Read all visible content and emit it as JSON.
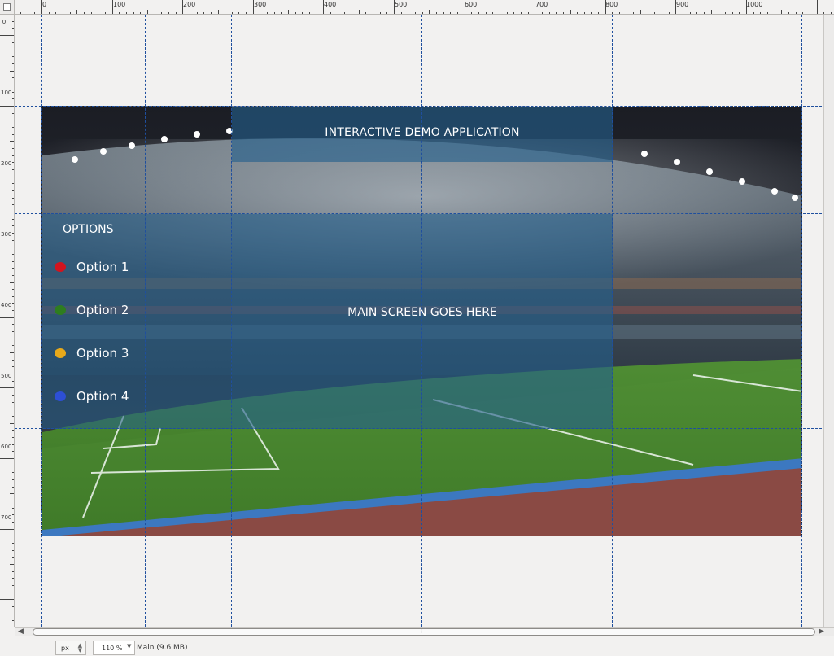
{
  "ruler": {
    "horizontal_labels": [
      "0",
      "100",
      "200",
      "300",
      "400",
      "500",
      "600",
      "700",
      "800",
      "900",
      "1000"
    ],
    "vertical_labels": [
      "0",
      "100",
      "200",
      "300",
      "400",
      "500",
      "600",
      "700"
    ]
  },
  "canvas": {
    "title": "INTERACTIVE DEMO APPLICATION",
    "main_screen": "MAIN SCREEN GOES HERE",
    "options_heading": "OPTIONS",
    "options": [
      {
        "label": "Option 1",
        "color": "#d2141e"
      },
      {
        "label": "Option 2",
        "color": "#2e7d1f"
      },
      {
        "label": "Option 3",
        "color": "#e8a91a"
      },
      {
        "label": "Option 4",
        "color": "#2d4fd6"
      }
    ]
  },
  "statusbar": {
    "unit": "px",
    "zoom": "110 %",
    "layer_info": "Main (9.6 MB)"
  }
}
